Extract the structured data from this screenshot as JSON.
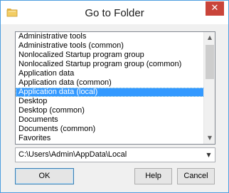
{
  "window": {
    "title": "Go to Folder",
    "close_glyph": "✕"
  },
  "folder_list": {
    "items": [
      "Administrative tools",
      "Administrative tools (common)",
      "Nonlocalized Startup program group",
      "Nonlocalized Startup program group (common)",
      "Application data",
      "Application data (common)",
      "Application data (local)",
      "Desktop",
      "Desktop (common)",
      "Documents",
      "Documents (common)",
      "Favorites"
    ],
    "selected_index": 6
  },
  "scrollbar": {
    "up_glyph": "▲",
    "down_glyph": "▼"
  },
  "path": {
    "value": "C:\\Users\\Admin\\AppData\\Local",
    "arrow_glyph": "▼"
  },
  "buttons": {
    "ok": "OK",
    "help": "Help",
    "cancel": "Cancel"
  },
  "colors": {
    "selection": "#3399ff",
    "close_button": "#c9443a",
    "window_border": "#4f9ee0"
  }
}
